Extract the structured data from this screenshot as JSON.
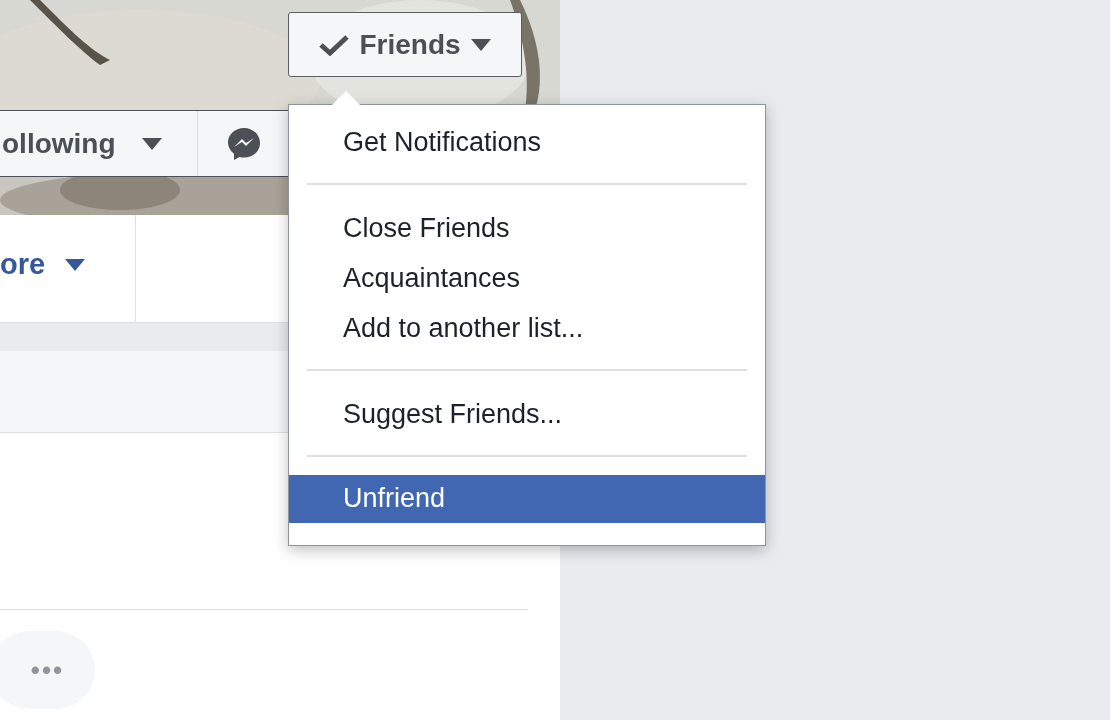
{
  "friends_button": {
    "label": "Friends"
  },
  "action_bar": [
    {
      "kind": "dropdown",
      "label": "ollowing"
    },
    {
      "kind": "messenger"
    }
  ],
  "tabs": [
    {
      "kind": "dropdown",
      "label": "ore"
    }
  ],
  "more_button": {
    "label": "•••"
  },
  "menu": {
    "items": [
      {
        "kind": "item",
        "label": "Get Notifications",
        "selected": false
      },
      {
        "kind": "separator"
      },
      {
        "kind": "item",
        "label": "Close Friends",
        "selected": false
      },
      {
        "kind": "item",
        "label": "Acquaintances",
        "selected": false
      },
      {
        "kind": "item",
        "label": "Add to another list...",
        "selected": false
      },
      {
        "kind": "separator"
      },
      {
        "kind": "item",
        "label": "Suggest Friends...",
        "selected": false
      },
      {
        "kind": "separator"
      },
      {
        "kind": "item",
        "label": "Unfriend",
        "selected": true
      }
    ]
  }
}
